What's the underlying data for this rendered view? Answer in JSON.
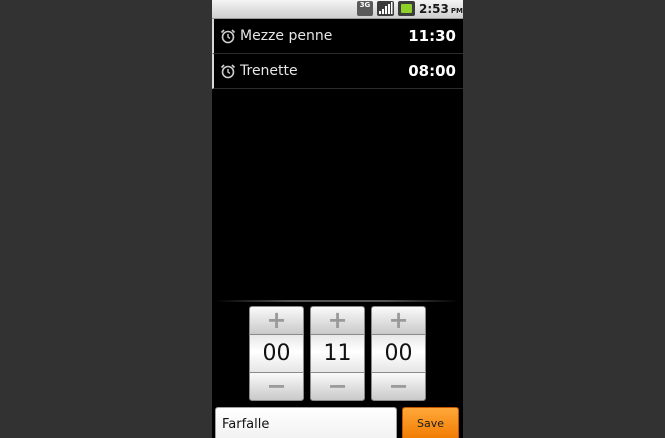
{
  "colors": {
    "status_bar_bg": "#e0e0e0",
    "app_bg": "#000000",
    "outer_bg": "#323232",
    "save_accent": "#f7941d",
    "battery_level": "#8ecf2a"
  },
  "status_bar": {
    "network_label": "3G",
    "time": "2:53",
    "ampm": "PM",
    "icons": [
      "3g-data-icon",
      "signal-strength-icon",
      "battery-charging-icon"
    ]
  },
  "alarms": [
    {
      "label": "Mezze penne",
      "time": "11:30",
      "icon": "alarm-clock-icon"
    },
    {
      "label": "Trenette",
      "time": "08:00",
      "icon": "alarm-clock-icon"
    }
  ],
  "pickers": [
    {
      "value": "00",
      "plus": "+",
      "minus": "−"
    },
    {
      "value": "11",
      "plus": "+",
      "minus": "−"
    },
    {
      "value": "00",
      "plus": "+",
      "minus": "−"
    }
  ],
  "form": {
    "name_value": "Farfalle",
    "save_label": "Save"
  }
}
